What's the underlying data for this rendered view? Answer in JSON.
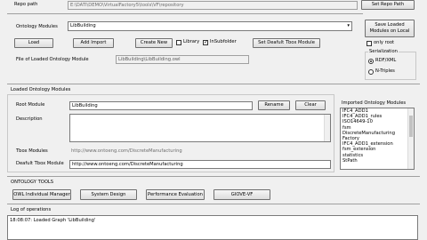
{
  "repo": {
    "label": "Repo path",
    "value": "E:\\DATI\\DEMO\\VirtualFactory5\\tools\\VF\\repository",
    "set_button": "Set Repo Path"
  },
  "ontology": {
    "label": "Ontology Modules",
    "selected": "LibBuilding",
    "buttons": {
      "load": "Load",
      "add_import": "Add Import",
      "create_new": "Create New",
      "set_default_tbox": "Set Deafult Tbox Module"
    },
    "checkbox_library": "Library",
    "checkbox_insubfolder": "InSubfolder",
    "file_label": "File of Loaded Ontology Module",
    "file_value": "LibBuilding\\LibBuilding.owl"
  },
  "save_panel": {
    "save_button_line1": "Save Loaded",
    "save_button_line2": "Modules on Local",
    "only_root": "only root",
    "serialization_label": "Serialization",
    "rdf_xml": "RDF/XML",
    "n_triples": "N-Triples"
  },
  "loaded_modules": {
    "title": "Loaded Ontology Modules",
    "root_label": "Root Module",
    "root_value": "LibBuilding",
    "rename_button": "Rename",
    "clear_button": "Clear",
    "description_label": "Description",
    "description_value": "",
    "tbox_label": "Tbox Modules",
    "tbox_value": "http://www.ontoeng.com/DiscreteManufacturing",
    "default_tbox_label": "Deafult Tbox Module",
    "default_tbox_value": "http://www.ontoeng.com/DiscreteManufacturing"
  },
  "imported": {
    "title": "Imported Ontology Modules",
    "items": [
      "IFC4_ADD1",
      "IFC4_ADD1_rules",
      "ISO14649-10",
      "fsm",
      "DiscreteManufacturing",
      "Factory",
      "IFC4_ADD1_extension",
      "fsm_extension",
      "statistics",
      "StPath"
    ]
  },
  "tools": {
    "title": "ONTOLOGY TOOLS",
    "owl_manager": "OWL Individual Manager",
    "system_design": "System Design",
    "performance": "Performance Evaluation",
    "giove": "GIOVE-VF"
  },
  "log": {
    "title": "Log of operations",
    "entries": [
      "18:08:07: Loaded Graph 'LibBuilding'"
    ]
  }
}
